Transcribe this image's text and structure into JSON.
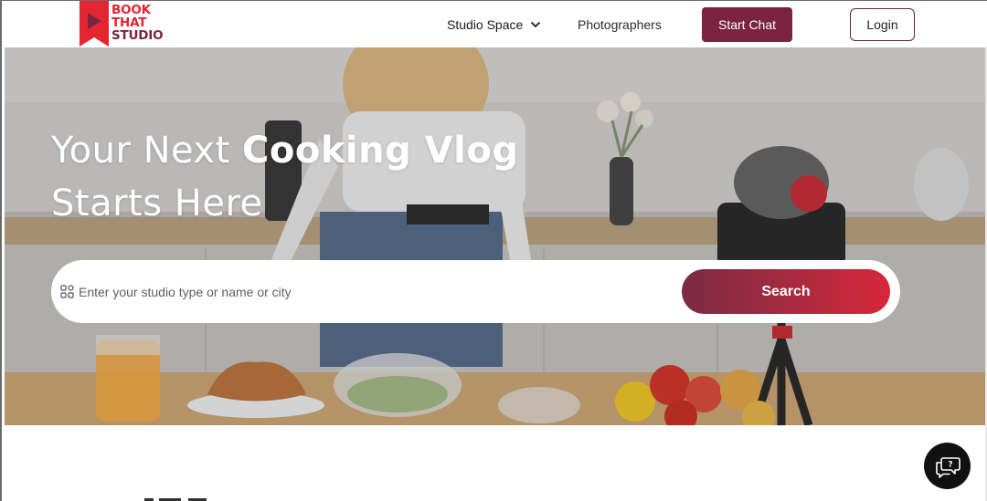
{
  "brand": {
    "logo_line1": "BOOK",
    "logo_line2": "THAT",
    "logo_line3": "STUDIO",
    "colors": {
      "red": "#e32631",
      "maroon": "#7b2441"
    }
  },
  "nav": {
    "studio_space": "Studio Space",
    "photographers": "Photographers",
    "start_chat": "Start Chat",
    "login": "Login"
  },
  "hero": {
    "title_prefix": "Your Next ",
    "title_bold": "Cooking Vlog",
    "title_line2": "Starts Here"
  },
  "search": {
    "placeholder": "Enter your studio type or name or city",
    "value": "",
    "button_label": "Search",
    "icon": "grid-icon"
  },
  "chat_fab": {
    "icon": "help-chat-icon"
  }
}
